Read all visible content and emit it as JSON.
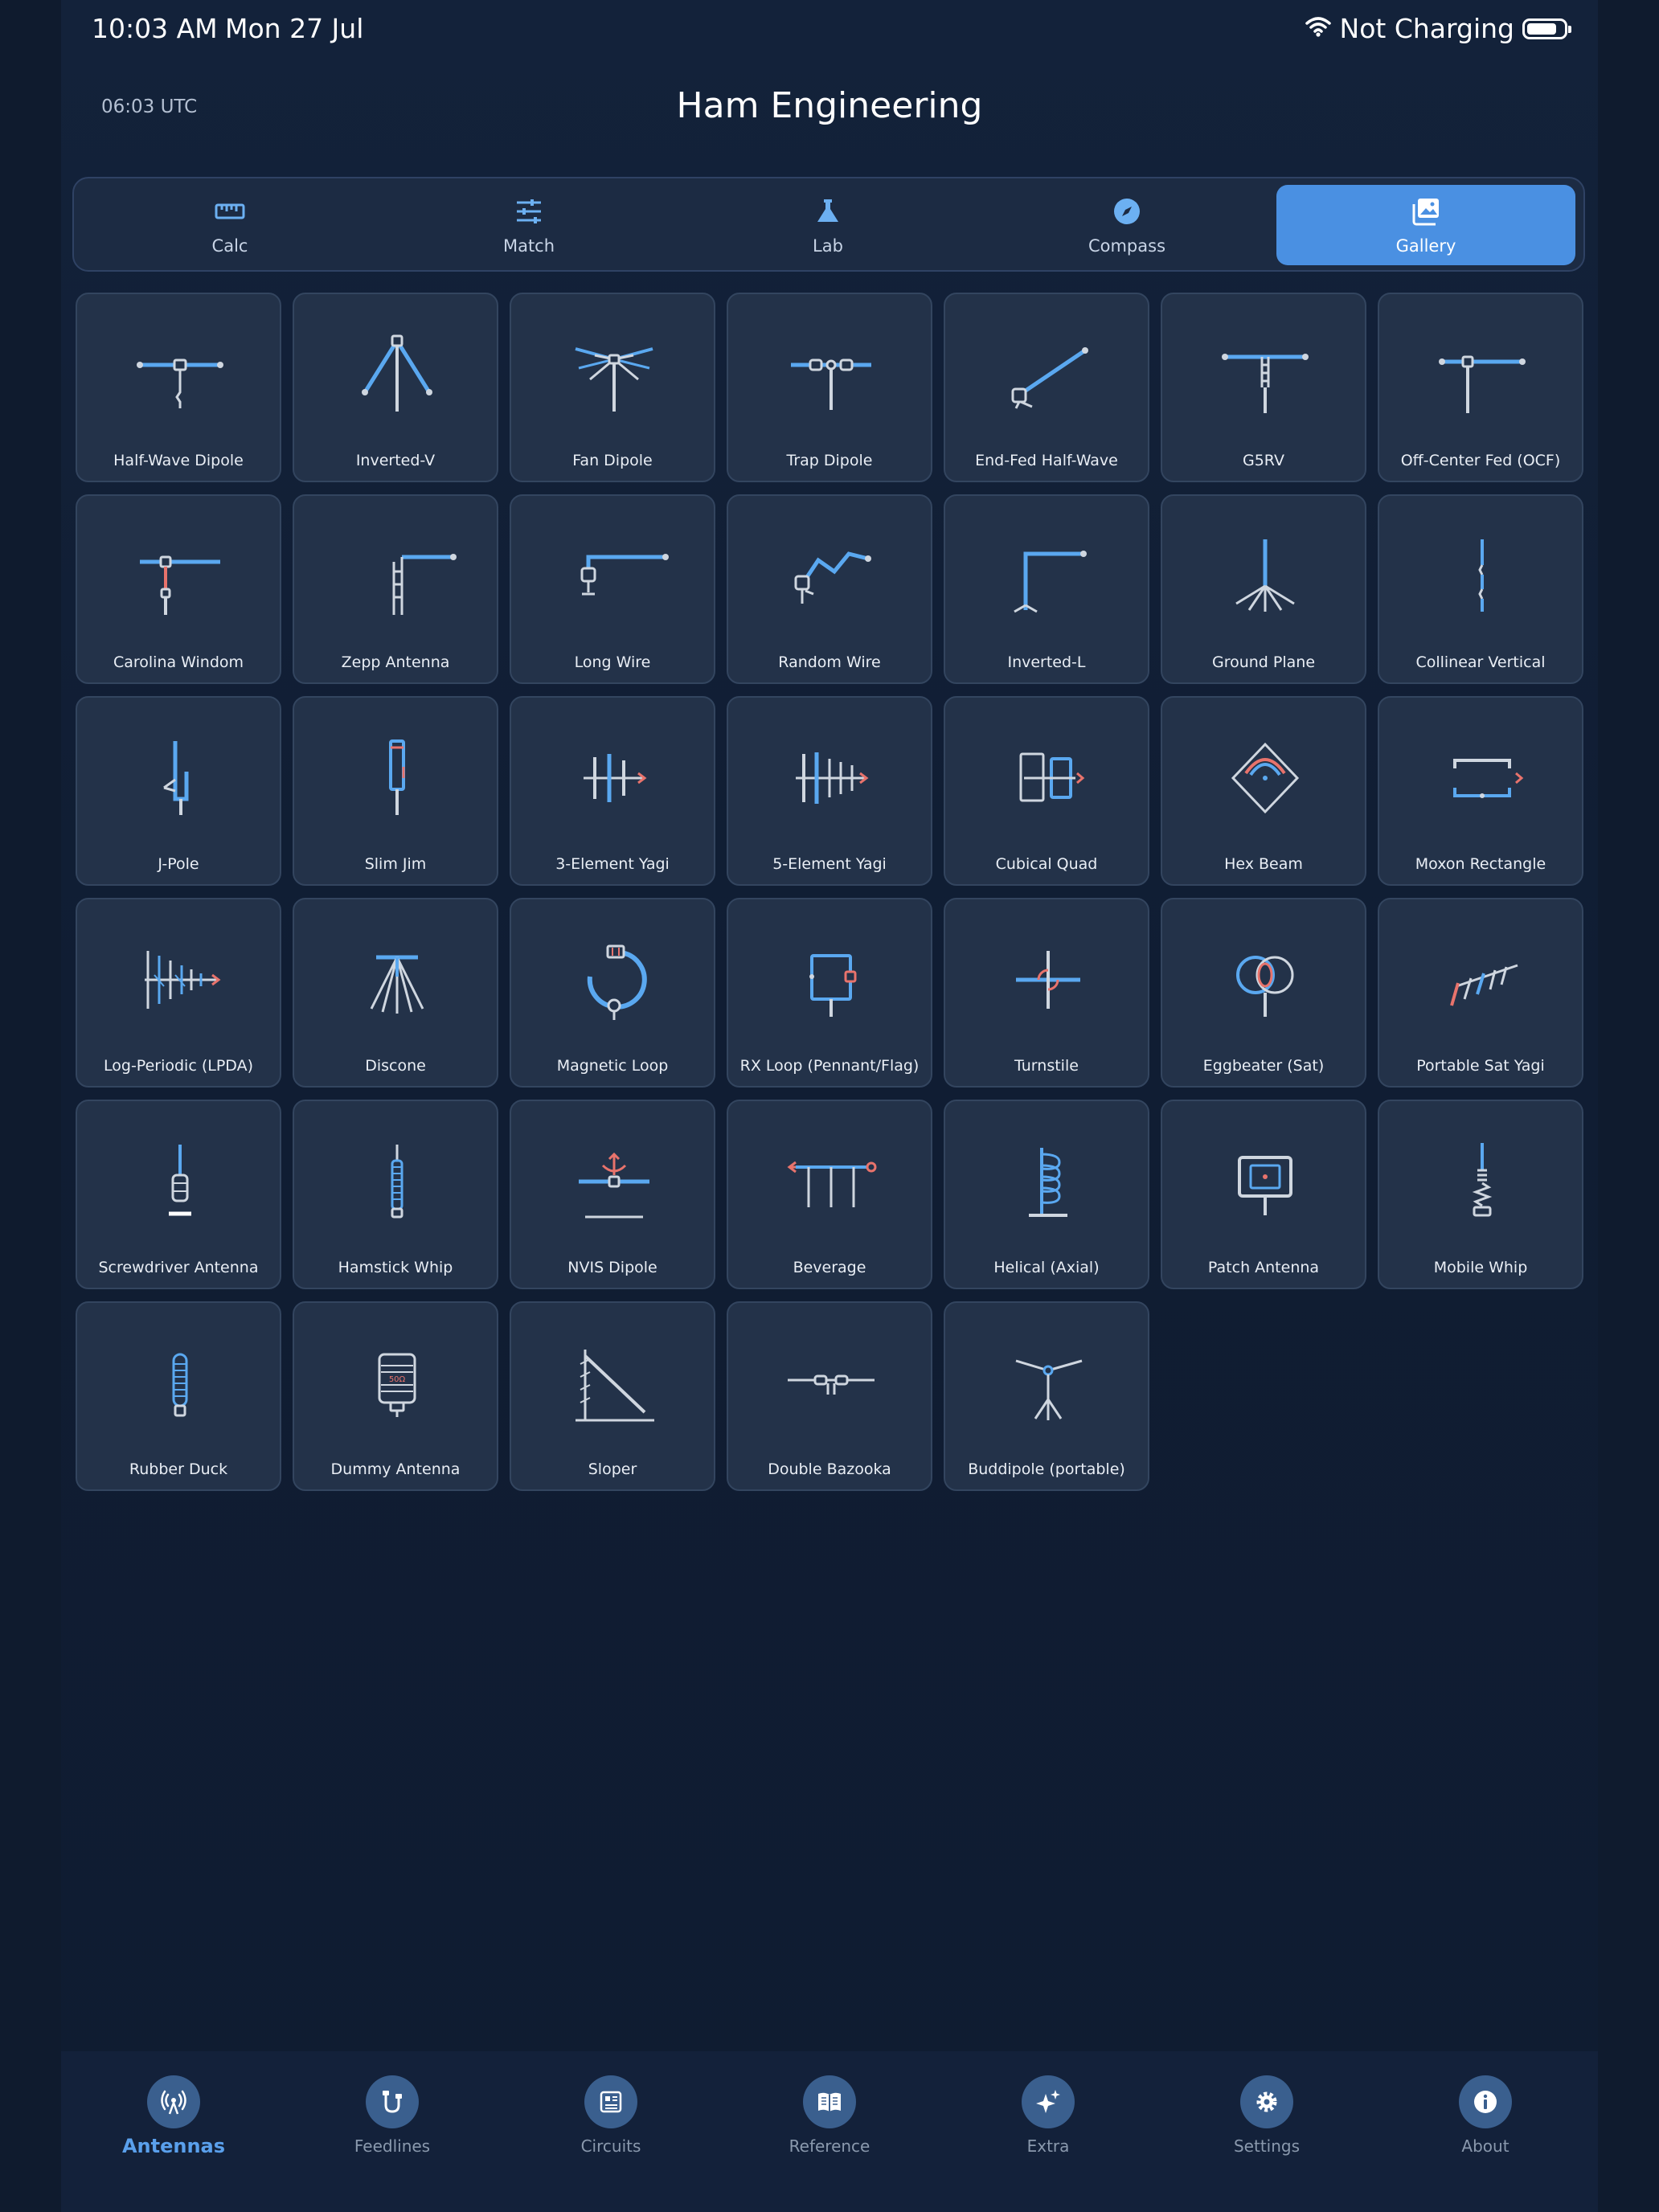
{
  "status": {
    "time": "10:03 AM",
    "date": "Mon 27 Jul",
    "charging": "Not Charging"
  },
  "header": {
    "utc": "06:03 UTC",
    "title": "Ham Engineering"
  },
  "segments": [
    {
      "label": "Calc",
      "icon": "ruler-icon",
      "active": false
    },
    {
      "label": "Match",
      "icon": "sliders-icon",
      "active": false
    },
    {
      "label": "Lab",
      "icon": "flask-icon",
      "active": false
    },
    {
      "label": "Compass",
      "icon": "compass-icon",
      "active": false
    },
    {
      "label": "Gallery",
      "icon": "gallery-icon",
      "active": true
    }
  ],
  "antennas": [
    {
      "label": "Half-Wave Dipole",
      "icon": "half-wave-dipole-icon"
    },
    {
      "label": "Inverted-V",
      "icon": "inverted-v-icon"
    },
    {
      "label": "Fan Dipole",
      "icon": "fan-dipole-icon"
    },
    {
      "label": "Trap Dipole",
      "icon": "trap-dipole-icon"
    },
    {
      "label": "End-Fed Half-Wave",
      "icon": "end-fed-half-wave-icon"
    },
    {
      "label": "G5RV",
      "icon": "g5rv-icon"
    },
    {
      "label": "Off-Center Fed (OCF)",
      "icon": "ocf-dipole-icon"
    },
    {
      "label": "Carolina Windom",
      "icon": "carolina-windom-icon"
    },
    {
      "label": "Zepp Antenna",
      "icon": "zepp-antenna-icon"
    },
    {
      "label": "Long Wire",
      "icon": "long-wire-icon"
    },
    {
      "label": "Random Wire",
      "icon": "random-wire-icon"
    },
    {
      "label": "Inverted-L",
      "icon": "inverted-l-icon"
    },
    {
      "label": "Ground Plane",
      "icon": "ground-plane-icon"
    },
    {
      "label": "Collinear Vertical",
      "icon": "collinear-vertical-icon"
    },
    {
      "label": "J-Pole",
      "icon": "j-pole-icon"
    },
    {
      "label": "Slim Jim",
      "icon": "slim-jim-icon"
    },
    {
      "label": "3-Element Yagi",
      "icon": "yagi-3-element-icon"
    },
    {
      "label": "5-Element Yagi",
      "icon": "yagi-5-element-icon"
    },
    {
      "label": "Cubical Quad",
      "icon": "cubical-quad-icon"
    },
    {
      "label": "Hex Beam",
      "icon": "hex-beam-icon"
    },
    {
      "label": "Moxon Rectangle",
      "icon": "moxon-rectangle-icon"
    },
    {
      "label": "Log-Periodic (LPDA)",
      "icon": "log-periodic-icon"
    },
    {
      "label": "Discone",
      "icon": "discone-icon"
    },
    {
      "label": "Magnetic Loop",
      "icon": "magnetic-loop-icon"
    },
    {
      "label": "RX Loop (Pennant/Flag)",
      "icon": "rx-loop-icon"
    },
    {
      "label": "Turnstile",
      "icon": "turnstile-icon"
    },
    {
      "label": "Eggbeater (Sat)",
      "icon": "eggbeater-icon"
    },
    {
      "label": "Portable Sat Yagi",
      "icon": "portable-sat-yagi-icon"
    },
    {
      "label": "Screwdriver Antenna",
      "icon": "screwdriver-antenna-icon"
    },
    {
      "label": "Hamstick Whip",
      "icon": "hamstick-whip-icon"
    },
    {
      "label": "NVIS Dipole",
      "icon": "nvis-dipole-icon"
    },
    {
      "label": "Beverage",
      "icon": "beverage-icon"
    },
    {
      "label": "Helical (Axial)",
      "icon": "helical-icon"
    },
    {
      "label": "Patch Antenna",
      "icon": "patch-antenna-icon"
    },
    {
      "label": "Mobile Whip",
      "icon": "mobile-whip-icon"
    },
    {
      "label": "Rubber Duck",
      "icon": "rubber-duck-icon"
    },
    {
      "label": "Dummy Antenna",
      "icon": "dummy-load-icon",
      "badge": "50Ω"
    },
    {
      "label": "Sloper",
      "icon": "sloper-icon"
    },
    {
      "label": "Double Bazooka",
      "icon": "double-bazooka-icon"
    },
    {
      "label": "Buddipole (portable)",
      "icon": "buddipole-icon"
    }
  ],
  "tabs": [
    {
      "label": "Antennas",
      "icon": "antenna-icon",
      "active": true
    },
    {
      "label": "Feedlines",
      "icon": "feedline-icon",
      "active": false
    },
    {
      "label": "Circuits",
      "icon": "circuit-icon",
      "active": false
    },
    {
      "label": "Reference",
      "icon": "book-icon",
      "active": false
    },
    {
      "label": "Extra",
      "icon": "sparkles-icon",
      "active": false
    },
    {
      "label": "Settings",
      "icon": "gear-icon",
      "active": false
    },
    {
      "label": "About",
      "icon": "info-icon",
      "active": false
    }
  ],
  "colors": {
    "accent": "#4a90e2",
    "blue_line": "#5aa8f0",
    "grey_line": "#cfd6df",
    "red_line": "#e8736c",
    "card_bg": "#233249"
  }
}
